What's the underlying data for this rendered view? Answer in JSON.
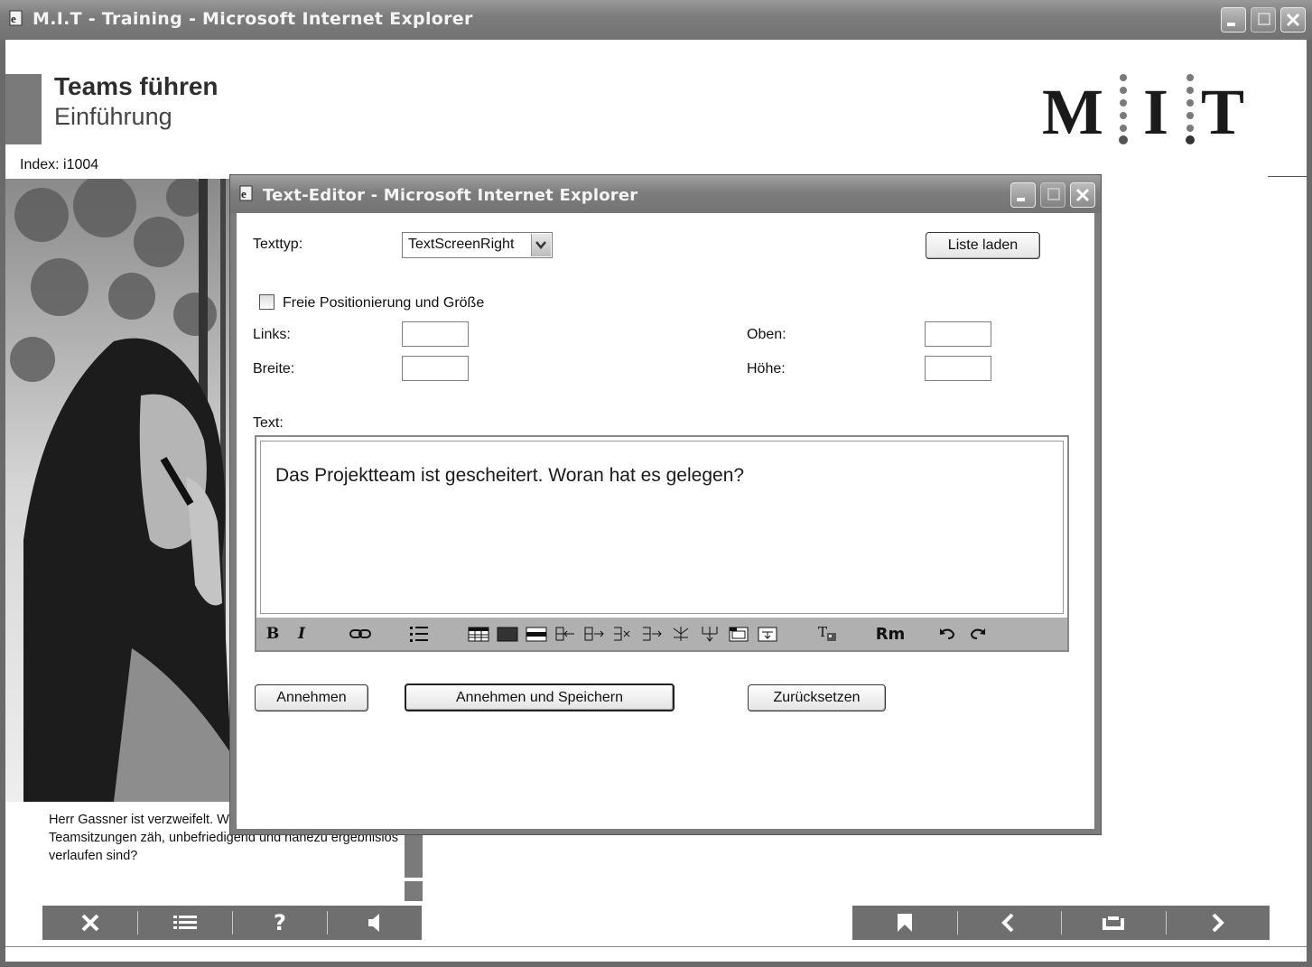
{
  "outer_window": {
    "title": "M.I.T - Training - Microsoft Internet Explorer"
  },
  "course": {
    "title": "Teams führen",
    "subtitle": "Einführung",
    "index": "Index: i1004",
    "logo_text": "M I T"
  },
  "caption": "Herr Gassner ist verzweifelt. Woran hat es gelegen, dass die Teamsitzungen zäh, unbefriedigend und nahezu ergebnislos verlaufen sind?",
  "dialog": {
    "title": "Text-Editor - Microsoft Internet Explorer",
    "texttyp_label": "Texttyp:",
    "texttyp_value": "TextScreenRight",
    "load_list_button": "Liste laden",
    "free_position_label": "Freie Positionierung und Größe",
    "free_position_checked": false,
    "links_label": "Links:",
    "links_value": "",
    "oben_label": "Oben:",
    "oben_value": "",
    "breite_label": "Breite:",
    "breite_value": "",
    "hoehe_label": "Höhe:",
    "hoehe_value": "",
    "text_label": "Text:",
    "editor_text": "Das Projektteam ist gescheitert. Woran hat es gelegen?",
    "toolbar": {
      "bold": "B",
      "italic": "I",
      "remove_format": "Rm"
    },
    "accept_button": "Annehmen",
    "accept_save_button": "Annehmen und Speichern",
    "reset_button": "Zurücksetzen"
  },
  "nav_left_icons": [
    "close-icon",
    "list-icon",
    "help-icon",
    "speaker-icon"
  ],
  "nav_right_icons": [
    "bookmark-icon",
    "back-icon",
    "repeat-icon",
    "forward-icon"
  ],
  "colors": {
    "navbar": "#6f6f6f",
    "titlebar": "#7d7d7d",
    "accent_bar": "#7a7a7a"
  }
}
